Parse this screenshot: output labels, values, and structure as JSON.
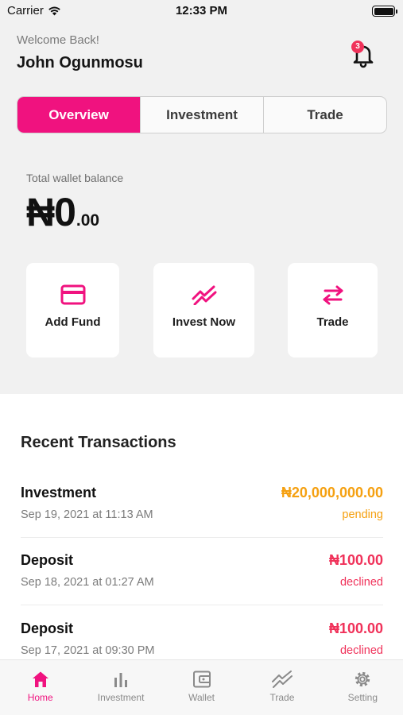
{
  "status_bar": {
    "carrier": "Carrier",
    "time": "12:33 PM"
  },
  "header": {
    "welcome": "Welcome Back!",
    "user_name": "John Ogunmosu",
    "notification_count": "3"
  },
  "tabs": [
    {
      "label": "Overview",
      "active": true
    },
    {
      "label": "Investment",
      "active": false
    },
    {
      "label": "Trade",
      "active": false
    }
  ],
  "wallet": {
    "label": "Total wallet balance",
    "amount_main": "₦0",
    "amount_cents": ".00"
  },
  "actions": [
    {
      "label": "Add Fund",
      "icon": "credit-card-icon"
    },
    {
      "label": "Invest Now",
      "icon": "trending-up-icon"
    },
    {
      "label": "Trade",
      "icon": "swap-arrows-icon"
    }
  ],
  "recent": {
    "title": "Recent Transactions",
    "items": [
      {
        "title": "Investment",
        "date": "Sep 19, 2021 at 11:13 AM",
        "amount": "₦20,000,000.00",
        "status": "pending",
        "color": "#f5a010"
      },
      {
        "title": "Deposit",
        "date": "Sep 18, 2021 at 01:27 AM",
        "amount": "₦100.00",
        "status": "declined",
        "color": "#f0325a"
      },
      {
        "title": "Deposit",
        "date": "Sep 17, 2021 at 09:30 PM",
        "amount": "₦100.00",
        "status": "declined",
        "color": "#f0325a"
      }
    ]
  },
  "tabbar": [
    {
      "label": "Home",
      "icon": "home-icon",
      "active": true
    },
    {
      "label": "Investment",
      "icon": "bar-chart-icon",
      "active": false
    },
    {
      "label": "Wallet",
      "icon": "wallet-icon",
      "active": false
    },
    {
      "label": "Trade",
      "icon": "trending-icon",
      "active": false
    },
    {
      "label": "Setting",
      "icon": "gear-icon",
      "active": false
    }
  ],
  "colors": {
    "accent": "#f0127f",
    "pending": "#f5a010",
    "declined": "#f0325a"
  }
}
